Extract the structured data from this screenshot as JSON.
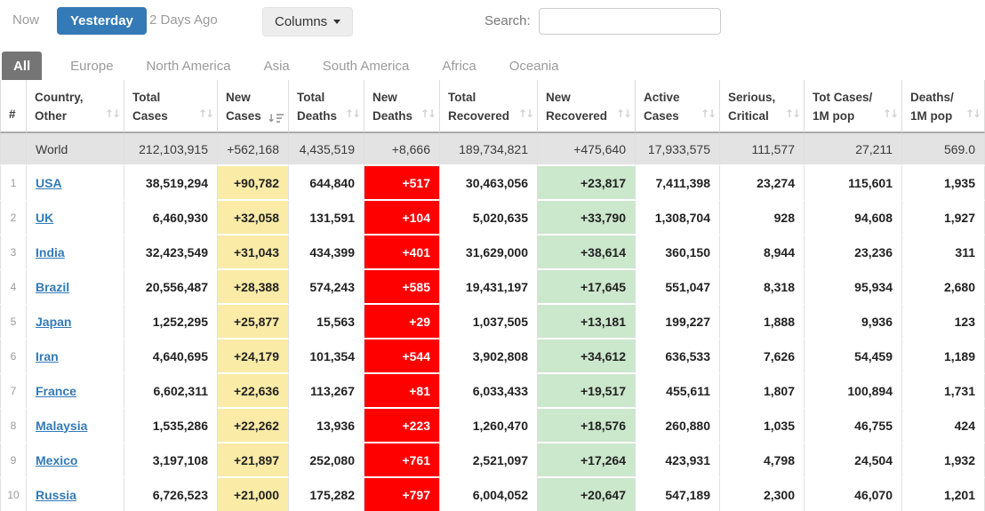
{
  "toolbar": {
    "now": "Now",
    "yesterday": "Yesterday",
    "two_days_ago": "2 Days Ago",
    "columns": "Columns",
    "search_label": "Search:",
    "search_value": ""
  },
  "tabs": [
    {
      "label": "All",
      "active": true
    },
    {
      "label": "Europe",
      "active": false
    },
    {
      "label": "North America",
      "active": false
    },
    {
      "label": "Asia",
      "active": false
    },
    {
      "label": "South America",
      "active": false
    },
    {
      "label": "Africa",
      "active": false
    },
    {
      "label": "Oceania",
      "active": false
    }
  ],
  "table": {
    "columns": [
      {
        "l1": "#",
        "l2": "",
        "sort": "none"
      },
      {
        "l1": "Country,",
        "l2": "Other",
        "sort": "both"
      },
      {
        "l1": "Total",
        "l2": "Cases",
        "sort": "both"
      },
      {
        "l1": "New",
        "l2": "Cases",
        "sort": "desc"
      },
      {
        "l1": "Total",
        "l2": "Deaths",
        "sort": "both"
      },
      {
        "l1": "New",
        "l2": "Deaths",
        "sort": "both"
      },
      {
        "l1": "Total",
        "l2": "Recovered",
        "sort": "both"
      },
      {
        "l1": "New",
        "l2": "Recovered",
        "sort": "both"
      },
      {
        "l1": "Active",
        "l2": "Cases",
        "sort": "both"
      },
      {
        "l1": "Serious,",
        "l2": "Critical",
        "sort": "both"
      },
      {
        "l1": "Tot Cases/",
        "l2": "1M pop",
        "sort": "both"
      },
      {
        "l1": "Deaths/",
        "l2": "1M pop",
        "sort": "both"
      }
    ],
    "world_row": {
      "rank": "",
      "country": "World",
      "total_cases": "212,103,915",
      "new_cases": "+562,168",
      "total_deaths": "4,435,519",
      "new_deaths": "+8,666",
      "total_recovered": "189,734,821",
      "new_recovered": "+475,640",
      "active_cases": "17,933,575",
      "serious_critical": "111,577",
      "cases_per_1m": "27,211",
      "deaths_per_1m": "569.0"
    },
    "rows": [
      {
        "rank": "1",
        "country": "USA",
        "total_cases": "38,519,294",
        "new_cases": "+90,782",
        "total_deaths": "644,840",
        "new_deaths": "+517",
        "total_recovered": "30,463,056",
        "new_recovered": "+23,817",
        "active_cases": "7,411,398",
        "serious_critical": "23,274",
        "cases_per_1m": "115,601",
        "deaths_per_1m": "1,935"
      },
      {
        "rank": "2",
        "country": "UK",
        "total_cases": "6,460,930",
        "new_cases": "+32,058",
        "total_deaths": "131,591",
        "new_deaths": "+104",
        "total_recovered": "5,020,635",
        "new_recovered": "+33,790",
        "active_cases": "1,308,704",
        "serious_critical": "928",
        "cases_per_1m": "94,608",
        "deaths_per_1m": "1,927"
      },
      {
        "rank": "3",
        "country": "India",
        "total_cases": "32,423,549",
        "new_cases": "+31,043",
        "total_deaths": "434,399",
        "new_deaths": "+401",
        "total_recovered": "31,629,000",
        "new_recovered": "+38,614",
        "active_cases": "360,150",
        "serious_critical": "8,944",
        "cases_per_1m": "23,236",
        "deaths_per_1m": "311"
      },
      {
        "rank": "4",
        "country": "Brazil",
        "total_cases": "20,556,487",
        "new_cases": "+28,388",
        "total_deaths": "574,243",
        "new_deaths": "+585",
        "total_recovered": "19,431,197",
        "new_recovered": "+17,645",
        "active_cases": "551,047",
        "serious_critical": "8,318",
        "cases_per_1m": "95,934",
        "deaths_per_1m": "2,680"
      },
      {
        "rank": "5",
        "country": "Japan",
        "total_cases": "1,252,295",
        "new_cases": "+25,877",
        "total_deaths": "15,563",
        "new_deaths": "+29",
        "total_recovered": "1,037,505",
        "new_recovered": "+13,181",
        "active_cases": "199,227",
        "serious_critical": "1,888",
        "cases_per_1m": "9,936",
        "deaths_per_1m": "123"
      },
      {
        "rank": "6",
        "country": "Iran",
        "total_cases": "4,640,695",
        "new_cases": "+24,179",
        "total_deaths": "101,354",
        "new_deaths": "+544",
        "total_recovered": "3,902,808",
        "new_recovered": "+34,612",
        "active_cases": "636,533",
        "serious_critical": "7,626",
        "cases_per_1m": "54,459",
        "deaths_per_1m": "1,189"
      },
      {
        "rank": "7",
        "country": "France",
        "total_cases": "6,602,311",
        "new_cases": "+22,636",
        "total_deaths": "113,267",
        "new_deaths": "+81",
        "total_recovered": "6,033,433",
        "new_recovered": "+19,517",
        "active_cases": "455,611",
        "serious_critical": "1,807",
        "cases_per_1m": "100,894",
        "deaths_per_1m": "1,731"
      },
      {
        "rank": "8",
        "country": "Malaysia",
        "total_cases": "1,535,286",
        "new_cases": "+22,262",
        "total_deaths": "13,936",
        "new_deaths": "+223",
        "total_recovered": "1,260,470",
        "new_recovered": "+18,576",
        "active_cases": "260,880",
        "serious_critical": "1,035",
        "cases_per_1m": "46,755",
        "deaths_per_1m": "424"
      },
      {
        "rank": "9",
        "country": "Mexico",
        "total_cases": "3,197,108",
        "new_cases": "+21,897",
        "total_deaths": "252,080",
        "new_deaths": "+761",
        "total_recovered": "2,521,097",
        "new_recovered": "+17,264",
        "active_cases": "423,931",
        "serious_critical": "4,798",
        "cases_per_1m": "24,504",
        "deaths_per_1m": "1,932"
      },
      {
        "rank": "10",
        "country": "Russia",
        "total_cases": "6,726,523",
        "new_cases": "+21,000",
        "total_deaths": "175,282",
        "new_deaths": "+797",
        "total_recovered": "6,004,052",
        "new_recovered": "+20,647",
        "active_cases": "547,189",
        "serious_critical": "2,300",
        "cases_per_1m": "46,070",
        "deaths_per_1m": "1,201"
      }
    ]
  },
  "colors": {
    "active_button_blue": "#337ab7",
    "active_tab_gray": "#757575",
    "world_row_gray": "#e3e3e3",
    "new_cases_yellow": "#faeba6",
    "new_deaths_red": "#ff0000",
    "new_recovered_green": "#cbe7cc",
    "link_blue": "#337ab7"
  }
}
